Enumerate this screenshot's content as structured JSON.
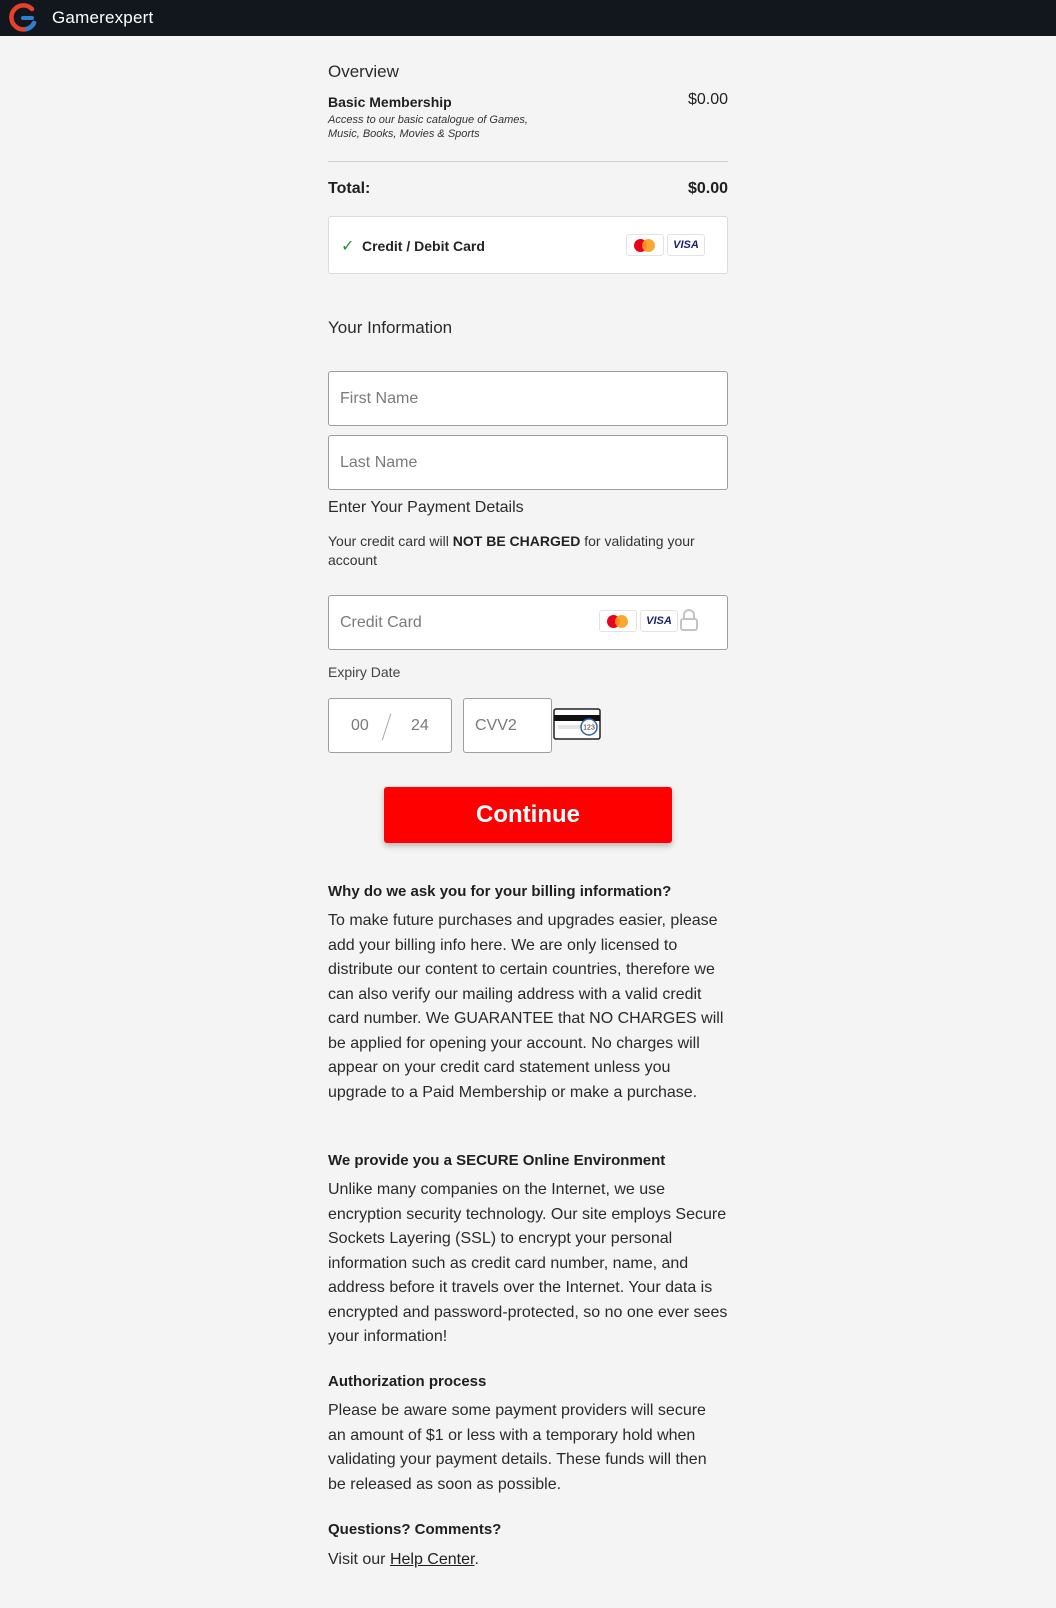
{
  "header": {
    "brand": "Gamerexpert"
  },
  "overview": {
    "title": "Overview",
    "plan_name": "Basic Membership",
    "plan_description": "Access to our basic catalogue of Games, Music, Books, Movies & Sports",
    "plan_price": "$0.00",
    "total_label": "Total:",
    "total_value": "$0.00"
  },
  "payment_method": {
    "label": "Credit / Debit Card",
    "visa_text": "VISA"
  },
  "your_info": {
    "title": "Your Information",
    "first_name_placeholder": "First Name",
    "last_name_placeholder": "Last Name"
  },
  "payment_details": {
    "title": "Enter Your Payment Details",
    "note_before": "Your credit card will ",
    "note_bold": "NOT BE CHARGED",
    "note_after": " for validating your account",
    "credit_card_placeholder": "Credit Card",
    "visa_text": "VISA",
    "expiry_label": "Expiry Date",
    "expiry_month": "00",
    "expiry_year": "24",
    "cvv_placeholder": "CVV2",
    "cvv_icon_text": "123"
  },
  "continue_label": "Continue",
  "faq": [
    {
      "title": "Why do we ask you for your billing information?",
      "body": "To make future purchases and upgrades easier, please add your billing info here. We are only licensed to distribute our content to certain countries, therefore we can also verify our mailing address with a valid credit card number. We GUARANTEE that NO CHARGES will be applied for opening your account. No charges will appear on your credit card statement unless you upgrade to a Paid Membership or make a purchase."
    },
    {
      "title": "We provide you a SECURE Online Environment",
      "body": "Unlike many companies on the Internet, we use encryption security technology. Our site employs Secure Sockets Layering (SSL) to encrypt your personal information such as credit card number, name, and address before it travels over the Internet. Your data is encrypted and password-protected, so no one ever sees your information!"
    },
    {
      "title": "Authorization process",
      "body": "Please be aware some payment providers will secure an amount of $1 or less with a temporary hold when validating your payment details. These funds will then be released as soon as possible."
    }
  ],
  "questions": {
    "title": "Questions? Comments?",
    "text_before": "Visit our ",
    "link_text": "Help Center",
    "text_after": "."
  },
  "colors": {
    "header_bg": "#11171c",
    "continue_bg": "#ff0000",
    "check_color": "#2c8a3b"
  }
}
